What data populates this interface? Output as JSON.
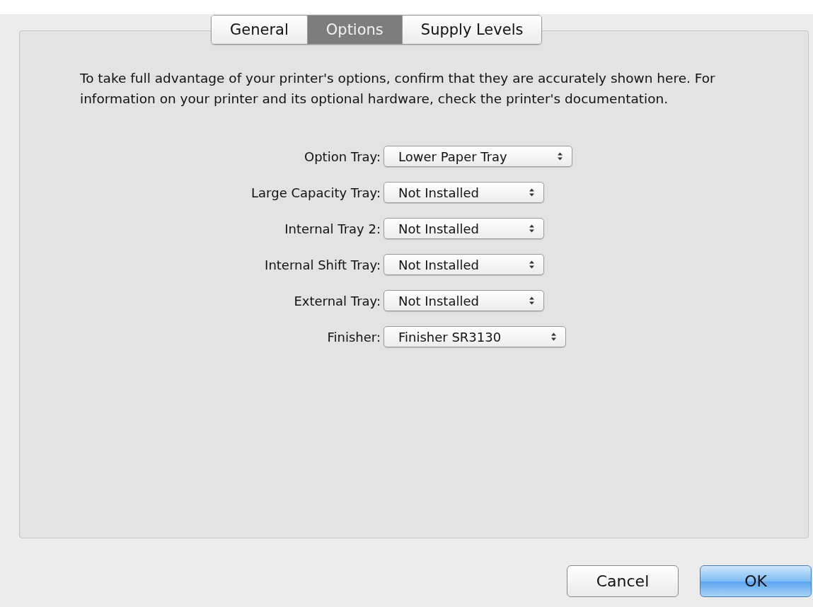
{
  "tabs": [
    {
      "label": "General",
      "selected": false
    },
    {
      "label": "Options",
      "selected": true
    },
    {
      "label": "Supply Levels",
      "selected": false
    }
  ],
  "description": "To take full advantage of your printer's options, confirm that they are accurately shown here. For information on your printer and its optional hardware, check the printer's documentation.",
  "options": [
    {
      "label": "Option Tray:",
      "value": "Lower Paper Tray"
    },
    {
      "label": "Large Capacity Tray:",
      "value": "Not Installed"
    },
    {
      "label": "Internal Tray 2:",
      "value": "Not Installed"
    },
    {
      "label": "Internal Shift Tray:",
      "value": "Not Installed"
    },
    {
      "label": "External Tray:",
      "value": "Not Installed"
    },
    {
      "label": "Finisher:",
      "value": "Finisher SR3130"
    }
  ],
  "buttons": [
    {
      "label": "Cancel",
      "kind": "normal"
    },
    {
      "label": "OK",
      "kind": "default"
    }
  ]
}
